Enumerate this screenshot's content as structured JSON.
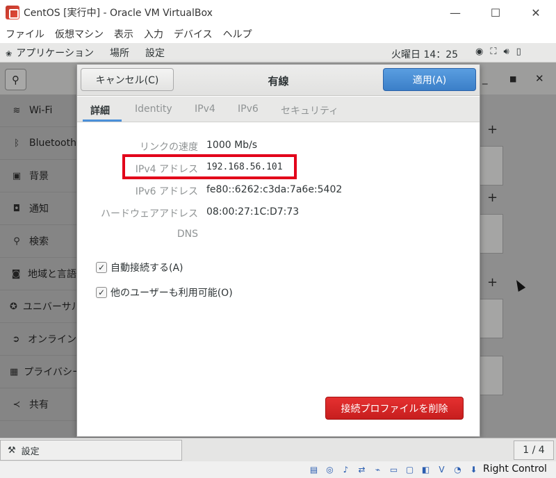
{
  "window": {
    "title": "CentOS [実行中] - Oracle VM VirtualBox",
    "minimize": "—",
    "maximize": "☐",
    "close": "✕"
  },
  "vb_menu": [
    "ファイル",
    "仮想マシン",
    "表示",
    "入力",
    "デバイス",
    "ヘルプ"
  ],
  "gnome_topbar": {
    "applications": "アプリケーション",
    "places": "場所",
    "settings": "設定",
    "clock": "火曜日 14：25",
    "tray_icons": [
      "network-icon",
      "wired-icon",
      "volume-icon",
      "battery-icon"
    ]
  },
  "settings_app": {
    "sidebar": [
      {
        "label": "Wi-Fi",
        "icon": "wifi-icon"
      },
      {
        "label": "Bluetooth",
        "icon": "bluetooth-icon"
      },
      {
        "label": "背景",
        "icon": "background-icon"
      },
      {
        "label": "通知",
        "icon": "notification-icon"
      },
      {
        "label": "検索",
        "icon": "search-icon"
      },
      {
        "label": "地域と言語",
        "icon": "region-icon"
      },
      {
        "label": "ユニバーサル",
        "icon": "accessibility-icon"
      },
      {
        "label": "オンライン",
        "icon": "online-accounts-icon"
      },
      {
        "label": "プライバシー",
        "icon": "privacy-icon"
      },
      {
        "label": "共有",
        "icon": "share-icon"
      }
    ]
  },
  "dialog": {
    "cancel": "キャンセル(C)",
    "title": "有線",
    "apply": "適用(A)",
    "tabs": [
      "詳細",
      "Identity",
      "IPv4",
      "IPv6",
      "セキュリティ"
    ],
    "active_tab": "詳細",
    "details": {
      "link_speed_label": "リンクの速度",
      "link_speed_value": "1000 Mb/s",
      "ipv4_label": "IPv4 アドレス",
      "ipv4_value": "192.168.56.101",
      "ipv6_label": "IPv6 アドレス",
      "ipv6_value": "fe80::6262:c3da:7a6e:5402",
      "hw_label": "ハードウェアアドレス",
      "hw_value": "08:00:27:1C:D7:73",
      "dns_label": "DNS",
      "dns_value": ""
    },
    "auto_connect": {
      "label": "自動接続する(A)",
      "checked": true
    },
    "all_users": {
      "label": "他のユーザーも利用可能(O)",
      "checked": true
    },
    "delete_profile": "接続プロファイルを削除"
  },
  "statusbar": {
    "settings_label": "設定",
    "pager": "1 / 4"
  },
  "vb_statusbar": {
    "host_key": "Right Control"
  },
  "colors": {
    "apply_blue": "#3b7fc8",
    "delete_red": "#d42a2a",
    "highlight_red": "#e2001a"
  }
}
